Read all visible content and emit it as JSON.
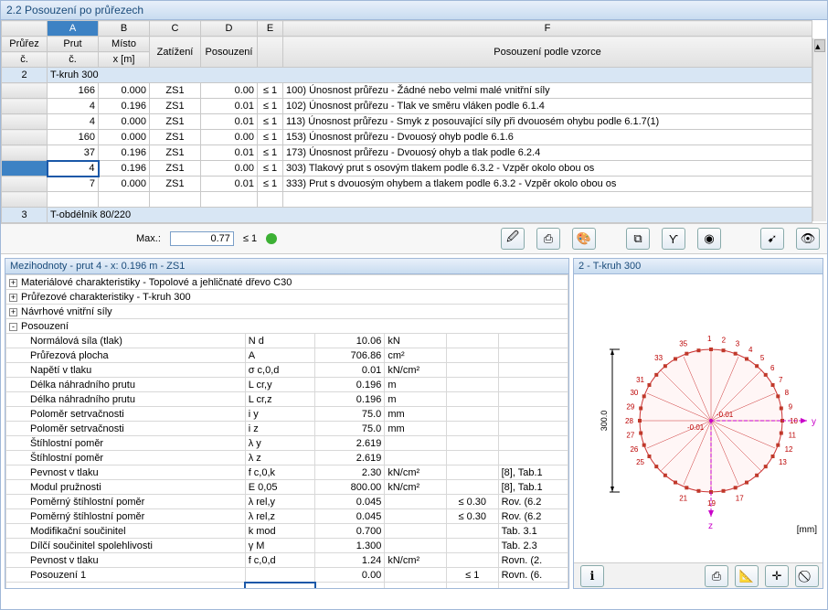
{
  "title": "2.2 Posouzení po průřezech",
  "topHeaders": {
    "cols": [
      "A",
      "B",
      "C",
      "D",
      "E",
      "F"
    ],
    "h1": [
      "Průřez",
      "Prut",
      "Místo",
      "",
      "",
      ""
    ],
    "h2": [
      "č.",
      "č.",
      "x [m]",
      "Zatížení",
      "Posouzení",
      "Posouzení podle vzorce"
    ]
  },
  "groups": [
    {
      "rowLabel": "2",
      "title": "T-kruh 300",
      "rows": [
        {
          "prut": "166",
          "x": "0.000",
          "zat": "ZS1",
          "pos": "0.00",
          "le": "≤ 1",
          "desc": "100) Únosnost průřezu - Žádné nebo velmi malé vnitřní síly"
        },
        {
          "prut": "4",
          "x": "0.196",
          "zat": "ZS1",
          "pos": "0.01",
          "le": "≤ 1",
          "desc": "102) Únosnost průřezu - Tlak ve směru vláken podle 6.1.4"
        },
        {
          "prut": "4",
          "x": "0.000",
          "zat": "ZS1",
          "pos": "0.01",
          "le": "≤ 1",
          "desc": "113) Únosnost průřezu - Smyk z posouvající síly při dvouosém ohybu podle 6.1.7(1)"
        },
        {
          "prut": "160",
          "x": "0.000",
          "zat": "ZS1",
          "pos": "0.00",
          "le": "≤ 1",
          "desc": "153) Únosnost průřezu - Dvouosý ohyb podle 6.1.6"
        },
        {
          "prut": "37",
          "x": "0.196",
          "zat": "ZS1",
          "pos": "0.01",
          "le": "≤ 1",
          "desc": "173) Únosnost průřezu - Dvouosý ohyb a tlak podle 6.2.4"
        },
        {
          "prut": "4",
          "x": "0.196",
          "zat": "ZS1",
          "pos": "0.00",
          "le": "≤ 1",
          "desc": "303) Tlakový prut s osovým tlakem podle 6.3.2 - Vzpěr okolo obou os",
          "sel": true
        },
        {
          "prut": "7",
          "x": "0.000",
          "zat": "ZS1",
          "pos": "0.01",
          "le": "≤ 1",
          "desc": "333) Prut s dvouosým ohybem a tlakem podle 6.3.2 - Vzpěr okolo obou os"
        }
      ]
    },
    {
      "rowLabel": "3",
      "title": "T-obdélník 80/220",
      "rows": []
    }
  ],
  "maxRow": {
    "label": "Max.:",
    "value": "0.77",
    "le": "≤ 1"
  },
  "detailTitle": "Mezihodnoty - prut 4 - x: 0.196 m - ZS1",
  "detailTree": [
    {
      "t": "Materiálové charakteristiky - Topolové a jehličnaté dřevo C30",
      "exp": "+"
    },
    {
      "t": "Průřezové charakteristiky - T-kruh 300",
      "exp": "+"
    },
    {
      "t": "Návrhové vnitřní síly",
      "exp": "+"
    },
    {
      "t": "Posouzení",
      "exp": "-"
    }
  ],
  "detailRows": [
    {
      "n": "Normálová síla (tlak)",
      "s": "N d",
      "v": "10.06",
      "u": "kN",
      "c": "",
      "r": ""
    },
    {
      "n": "Průřezová plocha",
      "s": "A",
      "v": "706.86",
      "u": "cm²",
      "c": "",
      "r": ""
    },
    {
      "n": "Napětí v tlaku",
      "s": "σ c,0,d",
      "v": "0.01",
      "u": "kN/cm²",
      "c": "",
      "r": ""
    },
    {
      "n": "Délka náhradního prutu",
      "s": "L cr,y",
      "v": "0.196",
      "u": "m",
      "c": "",
      "r": ""
    },
    {
      "n": "Délka náhradního prutu",
      "s": "L cr,z",
      "v": "0.196",
      "u": "m",
      "c": "",
      "r": ""
    },
    {
      "n": "Poloměr setrvačnosti",
      "s": "i y",
      "v": "75.0",
      "u": "mm",
      "c": "",
      "r": ""
    },
    {
      "n": "Poloměr setrvačnosti",
      "s": "i z",
      "v": "75.0",
      "u": "mm",
      "c": "",
      "r": ""
    },
    {
      "n": "Štíhlostní poměr",
      "s": "λ y",
      "v": "2.619",
      "u": "",
      "c": "",
      "r": ""
    },
    {
      "n": "Štíhlostní poměr",
      "s": "λ z",
      "v": "2.619",
      "u": "",
      "c": "",
      "r": ""
    },
    {
      "n": "Pevnost v tlaku",
      "s": "f c,0,k",
      "v": "2.30",
      "u": "kN/cm²",
      "c": "",
      "r": "[8], Tab.1"
    },
    {
      "n": "Modul pružnosti",
      "s": "E 0,05",
      "v": "800.00",
      "u": "kN/cm²",
      "c": "",
      "r": "[8], Tab.1"
    },
    {
      "n": "Poměrný štíhlostní poměr",
      "s": "λ rel,y",
      "v": "0.045",
      "u": "",
      "c": "≤ 0.30",
      "r": "Rov. (6.2"
    },
    {
      "n": "Poměrný štíhlostní poměr",
      "s": "λ rel,z",
      "v": "0.045",
      "u": "",
      "c": "≤ 0.30",
      "r": "Rov. (6.2"
    },
    {
      "n": "Modifikační součinitel",
      "s": "k mod",
      "v": "0.700",
      "u": "",
      "c": "",
      "r": "Tab. 3.1"
    },
    {
      "n": "Dílčí součinitel spolehlivosti",
      "s": "γ M",
      "v": "1.300",
      "u": "",
      "c": "",
      "r": "Tab. 2.3"
    },
    {
      "n": "Pevnost v tlaku",
      "s": "f c,0,d",
      "v": "1.24",
      "u": "kN/cm²",
      "c": "",
      "r": "Rovn. (2."
    },
    {
      "n": "Posouzení 1",
      "s": "",
      "v": "0.00",
      "u": "",
      "c": "≤ 1",
      "r": "Rovn. (6."
    }
  ],
  "rightTitle": "2 - T-kruh 300",
  "diagram": {
    "dim": "300.0",
    "offY": "-0.01",
    "offZ": "-0.01",
    "z": "z",
    "y": "y",
    "unit": "[mm]",
    "nodes": [
      1,
      2,
      3,
      4,
      5,
      6,
      7,
      8,
      9,
      10,
      11,
      12,
      13
    ]
  }
}
